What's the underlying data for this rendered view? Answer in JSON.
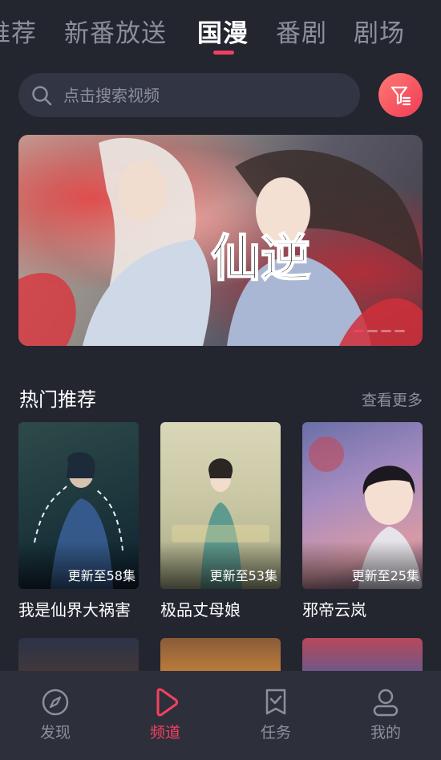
{
  "tabs": [
    {
      "label": "推荐"
    },
    {
      "label": "新番放送"
    },
    {
      "label": "国漫"
    },
    {
      "label": "番剧"
    },
    {
      "label": "剧场"
    }
  ],
  "active_tab": "国漫",
  "search": {
    "placeholder": "点击搜索视频",
    "icon": "search-icon"
  },
  "filter_button": {
    "icon": "filter-icon"
  },
  "banner": {
    "title_art_text": "仙逆",
    "slides": 4,
    "active_slide": 1
  },
  "hot_section": {
    "title": "热门推荐",
    "more_label": "查看更多",
    "items": [
      {
        "title": "我是仙界大祸害",
        "episodes": "更新至58集"
      },
      {
        "title": "极品丈母娘",
        "episodes": "更新至53集"
      },
      {
        "title": "邪帝云岚",
        "episodes": "更新至25集"
      }
    ]
  },
  "bottom_nav": [
    {
      "label": "发现",
      "icon": "compass-icon"
    },
    {
      "label": "频道",
      "icon": "play-icon"
    },
    {
      "label": "任务",
      "icon": "task-check-icon"
    },
    {
      "label": "我的",
      "icon": "user-icon"
    }
  ],
  "colors": {
    "accent": "#f2415f",
    "background": "#23252f",
    "muted_text": "#8d8f9c"
  }
}
